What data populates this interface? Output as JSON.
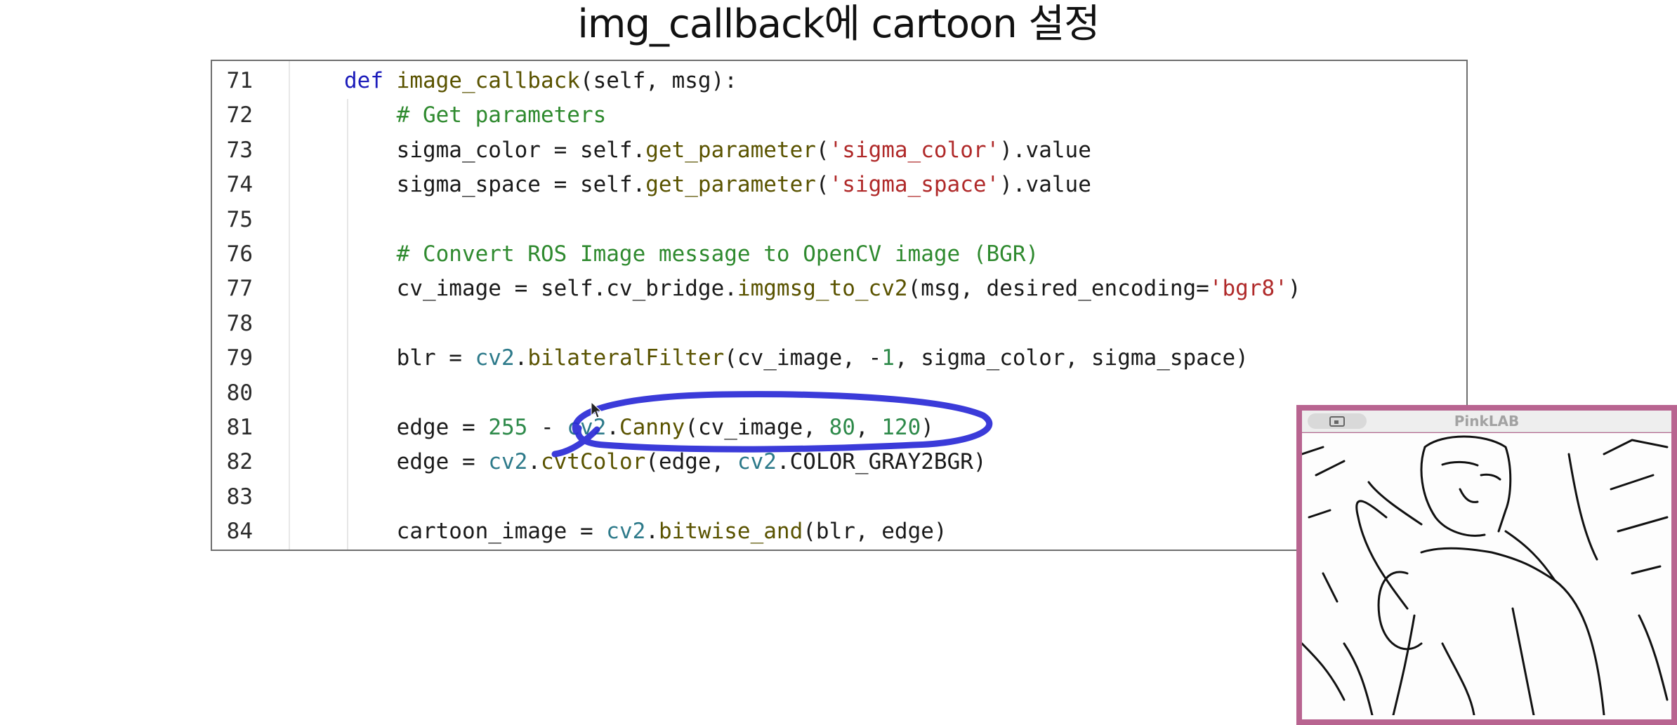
{
  "slide": {
    "title": "img_callback에 cartoon 설정"
  },
  "editor": {
    "lines": [
      {
        "no": "71",
        "tokens": [
          [
            "kw",
            "def "
          ],
          [
            "fn",
            "image_callback"
          ],
          [
            "pl",
            "(self, msg):"
          ]
        ],
        "indent": ""
      },
      {
        "no": "72",
        "tokens": [
          [
            "cm",
            "# Get parameters"
          ]
        ],
        "indent": "    "
      },
      {
        "no": "73",
        "tokens": [
          [
            "pl",
            "sigma_color = self."
          ],
          [
            "fn",
            "get_parameter"
          ],
          [
            "pl",
            "("
          ],
          [
            "str",
            "'sigma_color'"
          ],
          [
            "pl",
            ").value"
          ]
        ],
        "indent": "    "
      },
      {
        "no": "74",
        "tokens": [
          [
            "pl",
            "sigma_space = self."
          ],
          [
            "fn",
            "get_parameter"
          ],
          [
            "pl",
            "("
          ],
          [
            "str",
            "'sigma_space'"
          ],
          [
            "pl",
            ").value"
          ]
        ],
        "indent": "    "
      },
      {
        "no": "75",
        "tokens": [],
        "indent": ""
      },
      {
        "no": "76",
        "tokens": [
          [
            "cm",
            "# Convert ROS Image message to OpenCV image (BGR)"
          ]
        ],
        "indent": "    "
      },
      {
        "no": "77",
        "tokens": [
          [
            "pl",
            "cv_image = self.cv_bridge."
          ],
          [
            "fn",
            "imgmsg_to_cv2"
          ],
          [
            "pl",
            "(msg, desired_encoding="
          ],
          [
            "str",
            "'bgr8'"
          ],
          [
            "pl",
            ")"
          ]
        ],
        "indent": "    "
      },
      {
        "no": "78",
        "tokens": [],
        "indent": ""
      },
      {
        "no": "79",
        "tokens": [
          [
            "pl",
            "blr = "
          ],
          [
            "mod",
            "cv2"
          ],
          [
            "pl",
            "."
          ],
          [
            "fn",
            "bilateralFilter"
          ],
          [
            "pl",
            "(cv_image, -"
          ],
          [
            "num",
            "1"
          ],
          [
            "pl",
            ", sigma_color, sigma_space)"
          ]
        ],
        "indent": "    "
      },
      {
        "no": "80",
        "tokens": [],
        "indent": ""
      },
      {
        "no": "81",
        "tokens": [
          [
            "pl",
            "edge = "
          ],
          [
            "num",
            "255"
          ],
          [
            "pl",
            " - "
          ],
          [
            "mod",
            "cv2"
          ],
          [
            "pl",
            "."
          ],
          [
            "fn",
            "Canny"
          ],
          [
            "pl",
            "(cv_image, "
          ],
          [
            "num",
            "80"
          ],
          [
            "pl",
            ", "
          ],
          [
            "num",
            "120"
          ],
          [
            "pl",
            ")"
          ]
        ],
        "indent": "    "
      },
      {
        "no": "82",
        "tokens": [
          [
            "pl",
            "edge = "
          ],
          [
            "mod",
            "cv2"
          ],
          [
            "pl",
            "."
          ],
          [
            "fn",
            "cvtColor"
          ],
          [
            "pl",
            "(edge, "
          ],
          [
            "mod",
            "cv2"
          ],
          [
            "pl",
            ".COLOR_GRAY2BGR)"
          ]
        ],
        "indent": "    "
      },
      {
        "no": "83",
        "tokens": [],
        "indent": ""
      },
      {
        "no": "84",
        "tokens": [
          [
            "pl",
            "cartoon_image = "
          ],
          [
            "mod",
            "cv2"
          ],
          [
            "pl",
            "."
          ],
          [
            "fn",
            "bitwise_and"
          ],
          [
            "pl",
            "(blr, edge)"
          ]
        ],
        "indent": "    "
      }
    ]
  },
  "webcam": {
    "title": "PinkLAB"
  },
  "colors": {
    "annotation_ink": "#2a2ad6",
    "webcam_frame": "#b86490"
  },
  "icons": {
    "webcam_button": "screen-share-icon",
    "cursor": "cursor-arrow-icon"
  }
}
